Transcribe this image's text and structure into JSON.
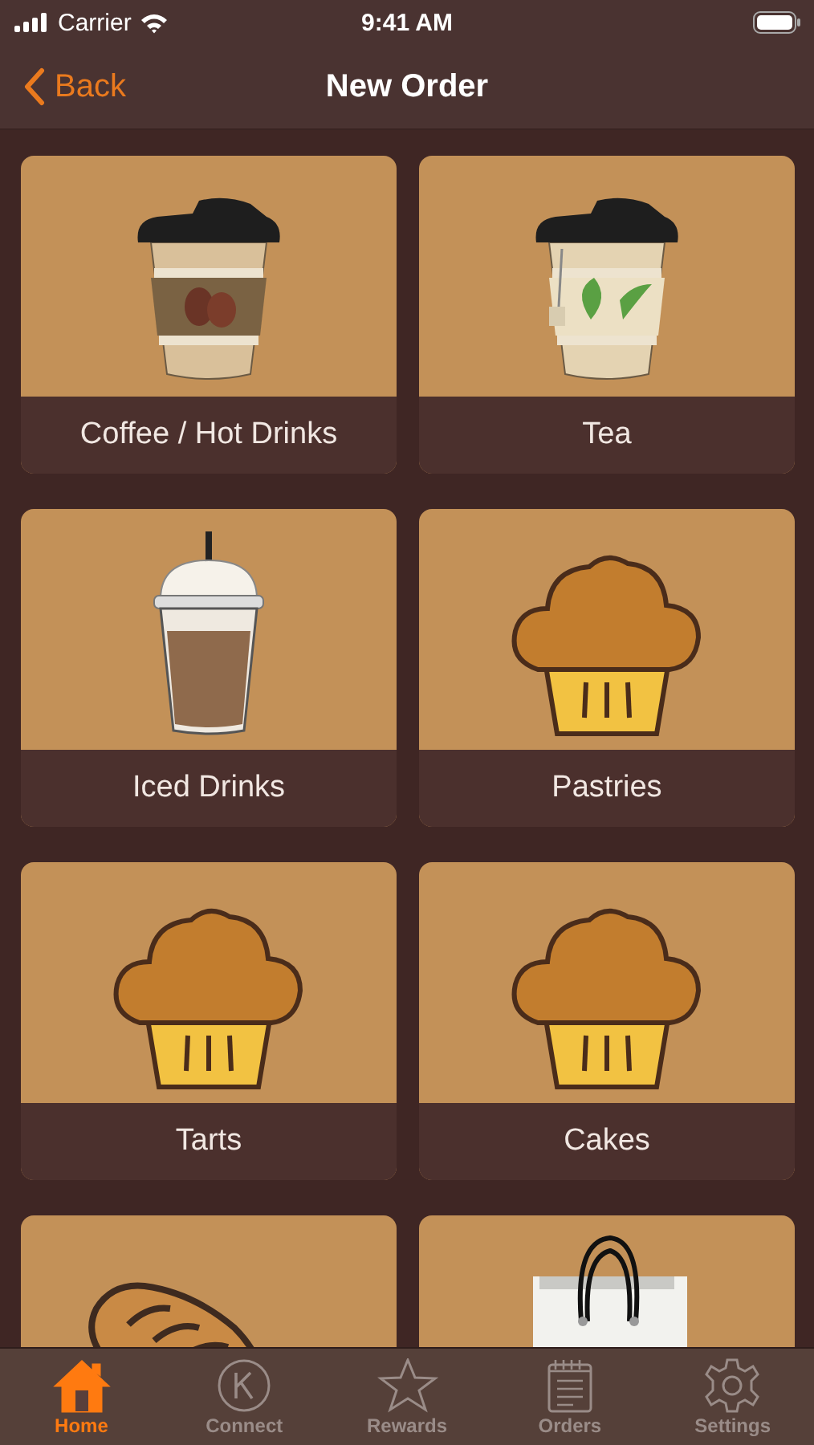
{
  "status_bar": {
    "carrier": "Carrier",
    "time": "9:41 AM"
  },
  "nav": {
    "back": "Back",
    "title": "New Order"
  },
  "categories": [
    {
      "kind": "coffee",
      "label": "Coffee / Hot Drinks"
    },
    {
      "kind": "tea",
      "label": "Tea"
    },
    {
      "kind": "iced",
      "label": "Iced Drinks"
    },
    {
      "kind": "muffin",
      "label": "Pastries"
    },
    {
      "kind": "muffin",
      "label": "Tarts"
    },
    {
      "kind": "muffin",
      "label": "Cakes"
    },
    {
      "kind": "bread"
    },
    {
      "kind": "bag"
    }
  ],
  "tabs": [
    {
      "kind": "home",
      "label": "Home",
      "selected": true
    },
    {
      "kind": "connect",
      "label": "Connect",
      "selected": false
    },
    {
      "kind": "rewards",
      "label": "Rewards",
      "selected": false
    },
    {
      "kind": "orders",
      "label": "Orders",
      "selected": false
    },
    {
      "kind": "settings",
      "label": "Settings",
      "selected": false
    }
  ]
}
